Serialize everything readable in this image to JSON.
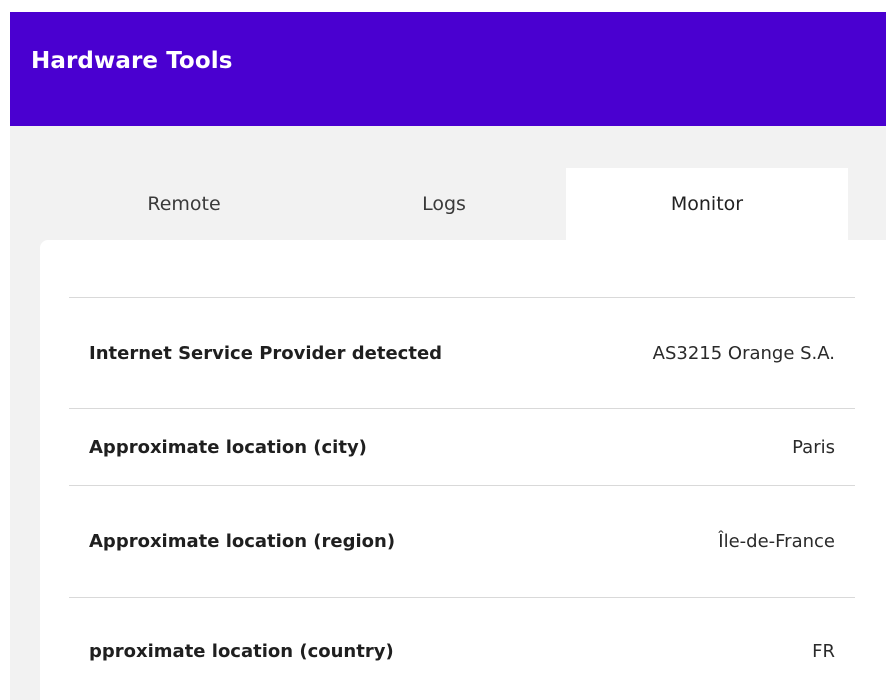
{
  "app": {
    "title": "Hardware Tools"
  },
  "tabs": [
    {
      "label": "Remote",
      "active": false
    },
    {
      "label": "Logs",
      "active": false
    },
    {
      "label": "Monitor",
      "active": true
    }
  ],
  "colors": {
    "app_bar": "#4a00d0",
    "background": "#f2f2f2",
    "card": "#ffffff",
    "divider": "#d9d9d9"
  },
  "monitor": {
    "rows": [
      {
        "label": "Internet Service Provider detected",
        "value": "AS3215 Orange S.A."
      },
      {
        "label": "Approximate location (city)",
        "value": "Paris"
      },
      {
        "label": "Approximate location (region)",
        "value": "Île-de-France"
      },
      {
        "label": "pproximate location (country)",
        "value": "FR"
      }
    ]
  }
}
